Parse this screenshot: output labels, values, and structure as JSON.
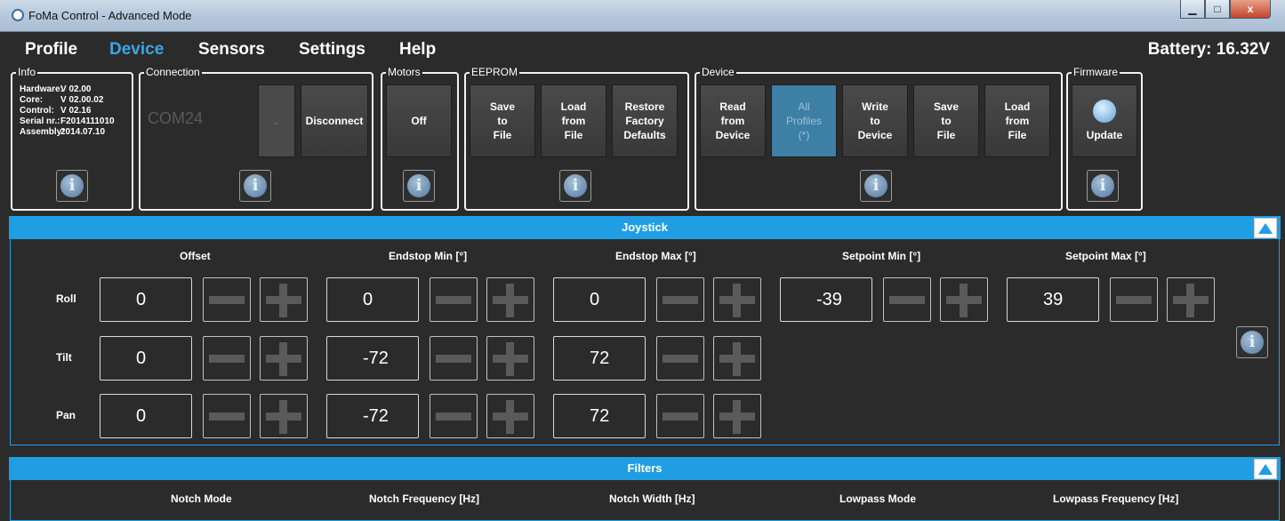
{
  "window": {
    "title": "FoMa Control - Advanced Mode",
    "minimize": "▁",
    "maximize": "□",
    "close": "x"
  },
  "menu": [
    "Profile",
    "Device",
    "Sensors",
    "Settings",
    "Help"
  ],
  "menu_active": "Device",
  "battery": "Battery: 16.32V",
  "info": {
    "title": "Info",
    "rows": [
      {
        "k": "Hardware:",
        "v": "V 02.00"
      },
      {
        "k": "Core:",
        "v": "V 02.00.02"
      },
      {
        "k": "Control:",
        "v": "V 02.16"
      },
      {
        "k": "Serial nr.:",
        "v": "F2014111010"
      },
      {
        "k": "Assembly:",
        "v": "2014.07.10"
      }
    ]
  },
  "connection": {
    "title": "Connection",
    "port": "COM24",
    "disconnect": "Disconnect"
  },
  "motors": {
    "title": "Motors",
    "toggle": "Off"
  },
  "eeprom": {
    "title": "EEPROM",
    "save": "Save\nto\nFile",
    "load": "Load\nfrom\nFile",
    "restore": "Restore\nFactory\nDefaults"
  },
  "device": {
    "title": "Device",
    "read": "Read\nfrom\nDevice",
    "all": "All\nProfiles\n(*)",
    "write": "Write\nto\nDevice",
    "save": "Save\nto\nFile",
    "load": "Load\nfrom\nFile"
  },
  "firmware": {
    "title": "Firmware",
    "update": "Update"
  },
  "info_glyph": "i",
  "joystick": {
    "title": "Joystick",
    "columns": [
      "Offset",
      "Endstop Min [°]",
      "Endstop Max [°]",
      "Setpoint Min [°]",
      "Setpoint Max [°]"
    ],
    "rows": [
      {
        "label": "Roll",
        "values": [
          "0",
          "0",
          "0",
          "-39",
          "39"
        ]
      },
      {
        "label": "Tilt",
        "values": [
          "0",
          "-72",
          "72"
        ]
      },
      {
        "label": "Pan",
        "values": [
          "0",
          "-72",
          "72"
        ]
      }
    ]
  },
  "filters": {
    "title": "Filters",
    "columns": [
      "Notch Mode",
      "Notch Frequency [Hz]",
      "Notch Width [Hz]",
      "Lowpass Mode",
      "Lowpass Frequency [Hz]"
    ]
  }
}
